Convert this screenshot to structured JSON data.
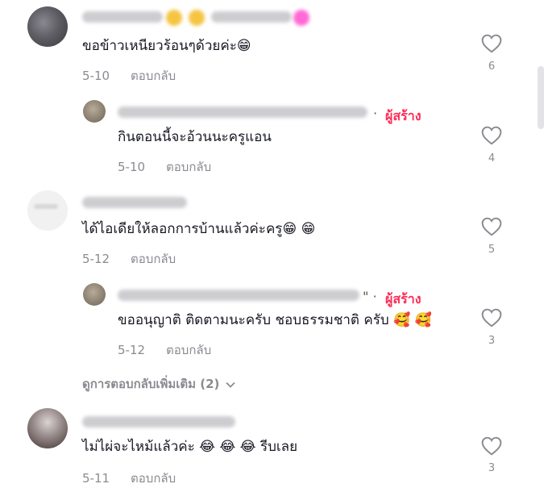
{
  "comments": [
    {
      "text": "ขอข้าวเหนียวร้อนๆด้วยค่ะ😁",
      "date": "5-10",
      "reply_label": "ตอบกลับ",
      "likes": "6",
      "creator": false
    },
    {
      "text": "กินตอนนี้จะอ้วนนะครูแอน",
      "date": "5-10",
      "reply_label": "ตอบกลับ",
      "likes": "4",
      "creator": true,
      "creator_label": "ผู้สร้าง",
      "separator": "·"
    },
    {
      "text": "ได้ไอเดียให้ลอกการบ้านแล้วค่ะครู😁 😁",
      "date": "5-12",
      "reply_label": "ตอบกลับ",
      "likes": "5",
      "creator": false
    },
    {
      "text": "ขออนุญาติ ติดตามนะครับ ชอบธรรมชาติ ครับ 🥰 🥰",
      "date": "5-12",
      "reply_label": "ตอบกลับ",
      "likes": "3",
      "creator": true,
      "creator_label": "ผู้สร้าง",
      "separator": "\" ·"
    },
    {
      "text": "ไม่ไผ่จะไหม้แล้วค่ะ 😂 😂 😂 รีบเลย",
      "date": "5-11",
      "reply_label": "ตอบกลับ",
      "likes": "3",
      "creator": false
    }
  ],
  "view_more": {
    "label": "ดูการตอบกลับเพิ่มเติม (2)"
  },
  "colors": {
    "creator": "#fe2c55",
    "meta": "#8a8b91",
    "text": "#161823"
  },
  "icons": {
    "like": "heart-outline-icon",
    "expand": "chevron-down-icon"
  }
}
